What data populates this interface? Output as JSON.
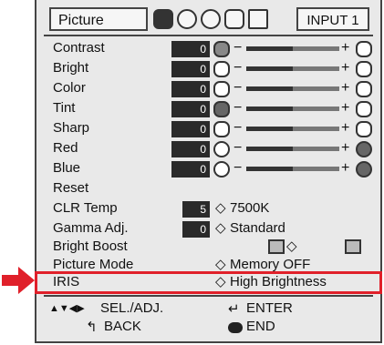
{
  "osd": {
    "tab_label": "Picture",
    "input_label": "INPUT 1"
  },
  "adjust_rows": [
    {
      "label": "Contrast",
      "value": "0"
    },
    {
      "label": "Bright",
      "value": "0"
    },
    {
      "label": "Color",
      "value": "0"
    },
    {
      "label": "Tint",
      "value": "0"
    },
    {
      "label": "Sharp",
      "value": "0"
    },
    {
      "label": "Red",
      "value": "0"
    },
    {
      "label": "Blue",
      "value": "0"
    }
  ],
  "slider_level": 0.5,
  "option_rows": {
    "reset": {
      "label": "Reset"
    },
    "clr_temp": {
      "label": "CLR Temp",
      "value": "5",
      "setting": "7500K"
    },
    "gamma": {
      "label": "Gamma Adj.",
      "value": "0",
      "setting": "Standard"
    },
    "bright_boost": {
      "label": "Bright Boost"
    },
    "picture_mode": {
      "label": "Picture Mode",
      "setting": "Memory OFF"
    },
    "iris": {
      "label": "IRIS",
      "setting": "High Brightness"
    }
  },
  "footer": {
    "sel_adj": "SEL./ADJ.",
    "back": "BACK",
    "enter": "ENTER",
    "end": "END"
  },
  "colors": {
    "highlight": "#e0202a",
    "arrow": "#e0202a"
  },
  "icons": {
    "nav_arrows": "▲▼◀▶",
    "back": "↰",
    "enter": "↵",
    "end": "end-button-icon",
    "diamond": "◇"
  }
}
